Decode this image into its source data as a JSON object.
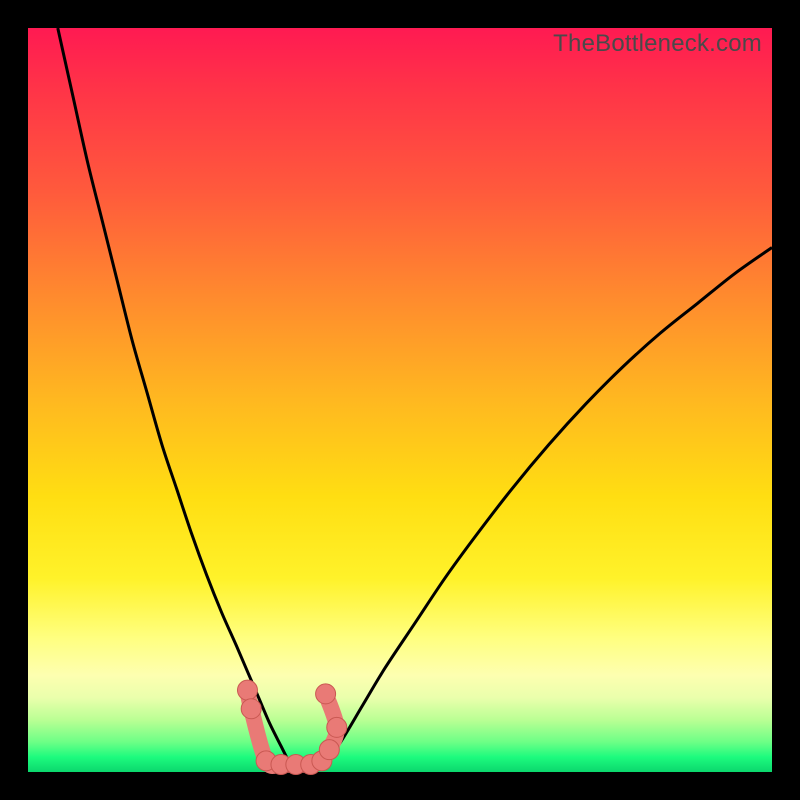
{
  "watermark": "TheBottleneck.com",
  "colors": {
    "stroke_curve": "#000000",
    "marker_fill": "#e97a76",
    "marker_stroke": "#c95852",
    "frame_bg": "#000000"
  },
  "chart_data": {
    "type": "line",
    "title": "",
    "xlabel": "",
    "ylabel": "",
    "xlim": [
      0,
      100
    ],
    "ylim": [
      0,
      100
    ],
    "grid": false,
    "series": [
      {
        "name": "left-curve",
        "x": [
          4,
          6,
          8,
          10,
          12,
          14,
          16,
          18,
          20,
          22,
          24,
          26,
          28,
          29.5,
          31,
          32.5,
          34,
          35
        ],
        "y": [
          100,
          91,
          82,
          74,
          66,
          58,
          51,
          44,
          38,
          32,
          26.5,
          21.5,
          17,
          13.5,
          10,
          6.5,
          3.5,
          1.5
        ]
      },
      {
        "name": "right-curve",
        "x": [
          40,
          42,
          45,
          48,
          52,
          56,
          60,
          65,
          70,
          75,
          80,
          85,
          90,
          95,
          100
        ],
        "y": [
          1.5,
          4,
          9,
          14,
          20,
          26,
          31.5,
          38,
          44,
          49.5,
          54.5,
          59,
          63,
          67,
          70.5
        ]
      },
      {
        "name": "markers-cluster",
        "x": [
          29.5,
          30,
          32,
          34,
          36,
          38,
          39.5,
          40.5,
          41.5,
          40
        ],
        "y": [
          11,
          8.5,
          1.5,
          1,
          1,
          1,
          1.5,
          3,
          6,
          10.5
        ]
      }
    ]
  }
}
